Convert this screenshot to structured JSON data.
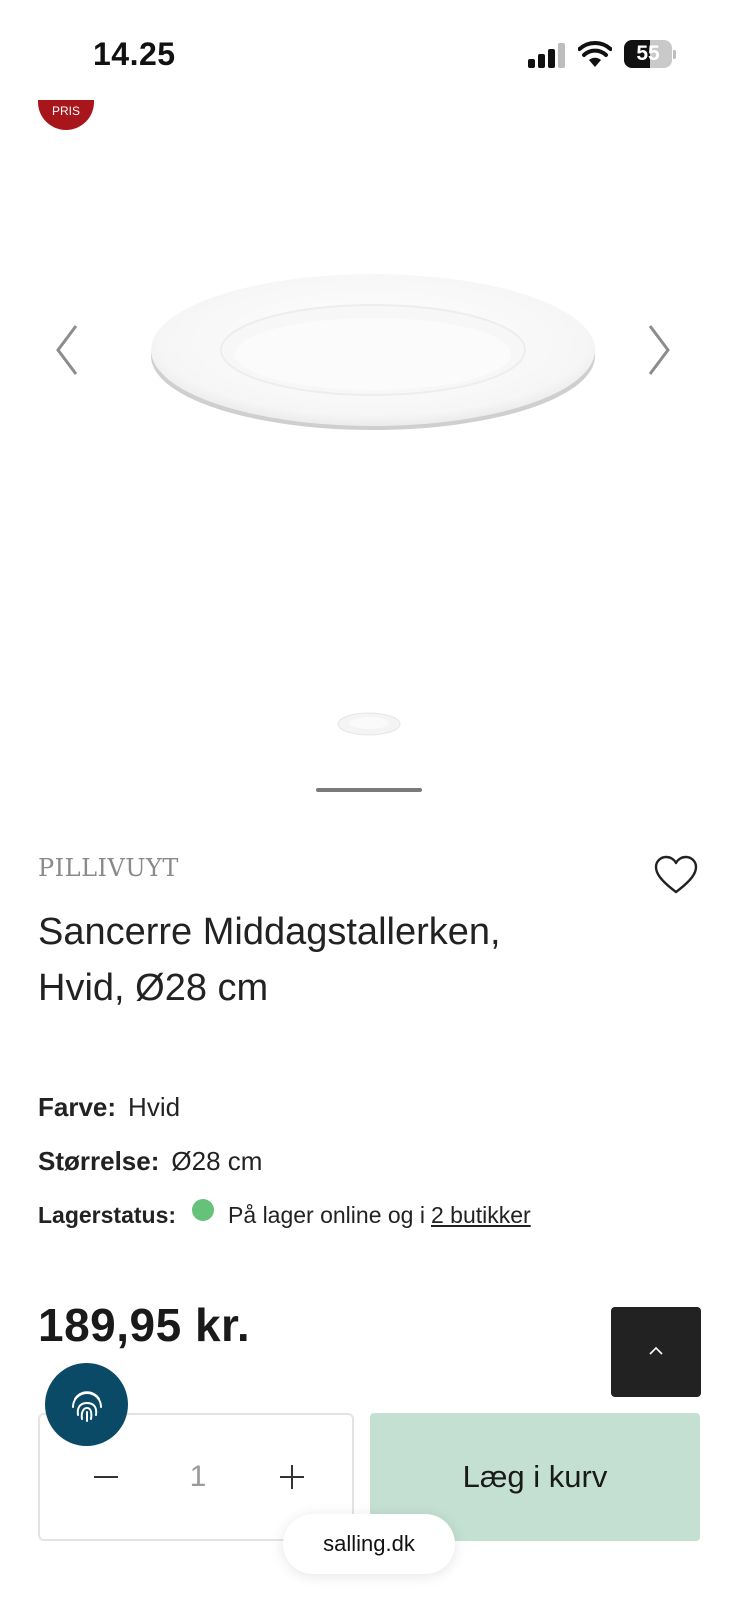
{
  "status_bar": {
    "time": "14.25",
    "battery_level": "55",
    "battery_fraction": 0.55
  },
  "badge": {
    "text": "PRIS"
  },
  "gallery": {
    "image_count": 1,
    "active_index": 1
  },
  "product": {
    "brand": "PILLIVUYT",
    "title_line1": "Sancerre Middagstallerken,",
    "title_line2": "Hvid, Ø28 cm",
    "specs": {
      "color_label": "Farve:",
      "color_value": "Hvid",
      "size_label": "Størrelse:",
      "size_value": "Ø28 cm"
    },
    "stock": {
      "label": "Lagerstatus:",
      "text": "På lager online og i",
      "link_text": "2 butikker",
      "status_color": "#66c17b"
    },
    "price": "189,95 kr."
  },
  "cart": {
    "quantity": "1",
    "add_label": "Læg i kurv",
    "button_color": "#c3e0d2"
  },
  "browser": {
    "url": "salling.dk"
  },
  "colors": {
    "badge_red": "#a8151b",
    "fingerprint_blue": "#0b4a66",
    "scroll_top_dark": "#222222"
  },
  "icons": {
    "prev": "chevron-left-icon",
    "next": "chevron-right-icon",
    "favorite": "heart-icon",
    "scroll_top": "chevron-up-icon",
    "fingerprint": "fingerprint-icon"
  }
}
